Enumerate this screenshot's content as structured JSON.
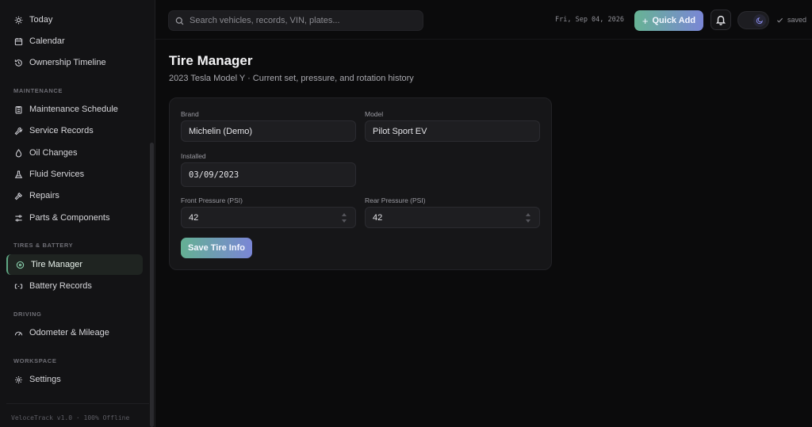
{
  "sidebar": {
    "items": [
      {
        "label": "Today",
        "icon": "sun-icon"
      },
      {
        "label": "Calendar",
        "icon": "calendar-icon"
      },
      {
        "label": "Ownership Timeline",
        "icon": "history-icon"
      },
      {
        "label": "Maintenance Schedule",
        "icon": "clipboard-icon"
      },
      {
        "label": "Service Records",
        "icon": "wrench-icon"
      },
      {
        "label": "Oil Changes",
        "icon": "droplet-icon"
      },
      {
        "label": "Fluid Services",
        "icon": "flask-icon"
      },
      {
        "label": "Repairs",
        "icon": "hammer-icon"
      },
      {
        "label": "Parts & Components",
        "icon": "sliders-icon"
      },
      {
        "label": "Tire Manager",
        "icon": "tire-icon"
      },
      {
        "label": "Battery Records",
        "icon": "battery-icon"
      },
      {
        "label": "Odometer & Mileage",
        "icon": "gauge-icon"
      },
      {
        "label": "Settings",
        "icon": "gear-icon"
      }
    ],
    "sections": {
      "maintenance": "MAINTENANCE",
      "tires_battery": "TIRES & BATTERY",
      "driving": "DRIVING",
      "workspace": "WORKSPACE"
    },
    "active_item": "Tire Manager",
    "footer": "VeloceTrack v1.0 · 100% Offline"
  },
  "topbar": {
    "search_placeholder": "Search vehicles, records, VIN, plates...",
    "date": "Fri, Sep 04, 2026",
    "quick_add_label": "Quick Add",
    "saved_label": "saved"
  },
  "page": {
    "title": "Tire Manager",
    "subtitle": "2023 Tesla Model Y · Current set, pressure, and rotation history"
  },
  "form": {
    "brand_label": "Brand",
    "brand_value": "Michelin (Demo)",
    "model_label": "Model",
    "model_value": "Pilot Sport EV",
    "installed_label": "Installed",
    "installed_value": "03/09/2023",
    "front_pressure_label": "Front Pressure (PSI)",
    "front_pressure_value": "42",
    "rear_pressure_label": "Rear Pressure (PSI)",
    "rear_pressure_value": "42",
    "save_label": "Save Tire Info"
  },
  "colors": {
    "accent_green": "#5fa884",
    "accent_gradient_start": "#67b394",
    "accent_gradient_end": "#7a86d6",
    "background": "#0b0b0c",
    "sidebar_bg": "#131315"
  }
}
